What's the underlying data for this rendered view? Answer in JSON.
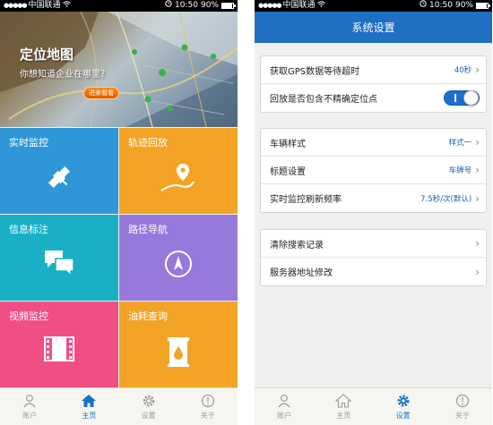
{
  "status_bar": {
    "carrier": "中国联通",
    "signal": "●●●●●",
    "time": "10:50",
    "battery": "90%",
    "battery_level": 0.9
  },
  "home": {
    "banner": {
      "title": "定位地图",
      "subtitle": "你想知道企业在哪里？",
      "button_label": "进来看看"
    },
    "tiles": [
      {
        "label": "实时监控",
        "icon": "satellite-icon",
        "color": "#2f97d8"
      },
      {
        "label": "轨迹回放",
        "icon": "location-pin-icon",
        "color": "#f3a426"
      },
      {
        "label": "信息标注",
        "icon": "chat-bubbles-icon",
        "color": "#19b0c6"
      },
      {
        "label": "路径导航",
        "icon": "compass-icon",
        "color": "#9778db"
      },
      {
        "label": "视频监控",
        "icon": "film-icon",
        "color": "#f04f84"
      },
      {
        "label": "油耗查询",
        "icon": "oil-barrel-icon",
        "color": "#f3a426"
      }
    ],
    "nav": [
      {
        "label": "账户",
        "icon": "user-icon",
        "active": false
      },
      {
        "label": "主页",
        "icon": "home-icon",
        "active": true
      },
      {
        "label": "设置",
        "icon": "gear-icon",
        "active": false
      },
      {
        "label": "关于",
        "icon": "info-icon",
        "active": false
      }
    ]
  },
  "settings": {
    "title": "系统设置",
    "groups": [
      [
        {
          "label": "获取GPS数据等待超时",
          "value": "40秒"
        },
        {
          "label": "回放是否包含不精确定位点",
          "toggle": true
        }
      ],
      [
        {
          "label": "车辆样式",
          "value": "样式一"
        },
        {
          "label": "标题设置",
          "value": "车牌号"
        },
        {
          "label": "实时监控刷新频率",
          "value": "7.5秒/次(默认)"
        }
      ],
      [
        {
          "label": "清除搜索记录"
        },
        {
          "label": "服务器地址修改"
        }
      ]
    ],
    "nav": [
      {
        "label": "账户",
        "icon": "user-icon",
        "active": false
      },
      {
        "label": "主页",
        "icon": "home-icon",
        "active": false
      },
      {
        "label": "设置",
        "icon": "gear-icon",
        "active": true
      },
      {
        "label": "关于",
        "icon": "info-icon",
        "active": false
      }
    ]
  },
  "colors": {
    "accent_blue": "#1f6fc3",
    "nav_active": "#1a73c8"
  }
}
